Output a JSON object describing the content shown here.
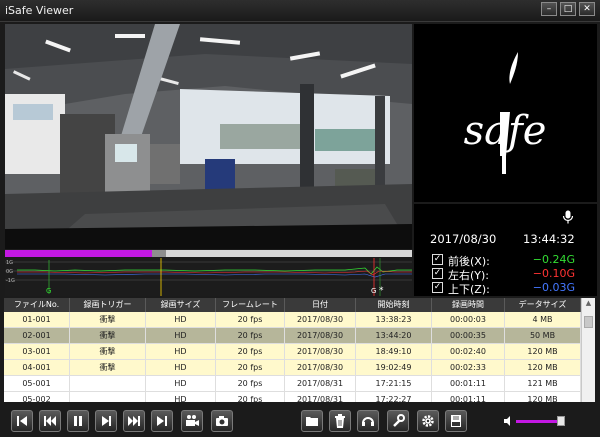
{
  "window": {
    "title": "iSafe Viewer"
  },
  "sensor": {
    "date": "2017/08/30",
    "time": "13:44:32",
    "rows": [
      {
        "label": "前後(X):",
        "value": "−0.24G",
        "color": "#33dd33",
        "checked": true
      },
      {
        "label": "左右(Y):",
        "value": "−0.10G",
        "color": "#ff3333",
        "checked": true
      },
      {
        "label": "上下(Z):",
        "value": "−0.03G",
        "color": "#4477ff",
        "checked": true
      }
    ]
  },
  "timeline": {
    "progress": 0.36
  },
  "graph": {
    "labels": [
      "1G",
      "0G",
      "-1G"
    ],
    "marker_label": "G"
  },
  "table": {
    "headers": [
      "ファイルNo.",
      "録画トリガー",
      "録画サイズ",
      "フレームレート",
      "日付",
      "開始時刻",
      "録画時間",
      "データサイズ"
    ],
    "rows": [
      [
        "01-001",
        "衝撃",
        "HD",
        "20 fps",
        "2017/08/30",
        "13:38:23",
        "00:00:03",
        "4 MB"
      ],
      [
        "02-001",
        "衝撃",
        "HD",
        "20 fps",
        "2017/08/30",
        "13:44:20",
        "00:00:35",
        "50 MB"
      ],
      [
        "03-001",
        "衝撃",
        "HD",
        "20 fps",
        "2017/08/30",
        "18:49:10",
        "00:02:40",
        "120 MB"
      ],
      [
        "04-001",
        "衝撃",
        "HD",
        "20 fps",
        "2017/08/30",
        "19:02:49",
        "00:02:33",
        "120 MB"
      ],
      [
        "05-001",
        "",
        "HD",
        "20 fps",
        "2017/08/31",
        "17:21:15",
        "00:01:11",
        "121 MB"
      ],
      [
        "05-002",
        "",
        "HD",
        "20 fps",
        "2017/08/31",
        "17:22:27",
        "00:01:11",
        "120 MB"
      ]
    ],
    "row_styles": [
      "yellow",
      "selected",
      "yellow",
      "yellow",
      "white",
      "white"
    ],
    "selected_row": 1
  },
  "toolbar": {
    "buttons": [
      "skip-start",
      "rewind",
      "pause",
      "step-forward",
      "fast-forward",
      "skip-end",
      "camera",
      "snapshot",
      "folder",
      "trash",
      "settings-rec",
      "tools",
      "gear",
      "csv-export"
    ],
    "volume": 0.9
  },
  "colors": {
    "accent": "#c318e3",
    "row_highlight": "#fff9cc",
    "row_selected": "#b6b69a"
  }
}
